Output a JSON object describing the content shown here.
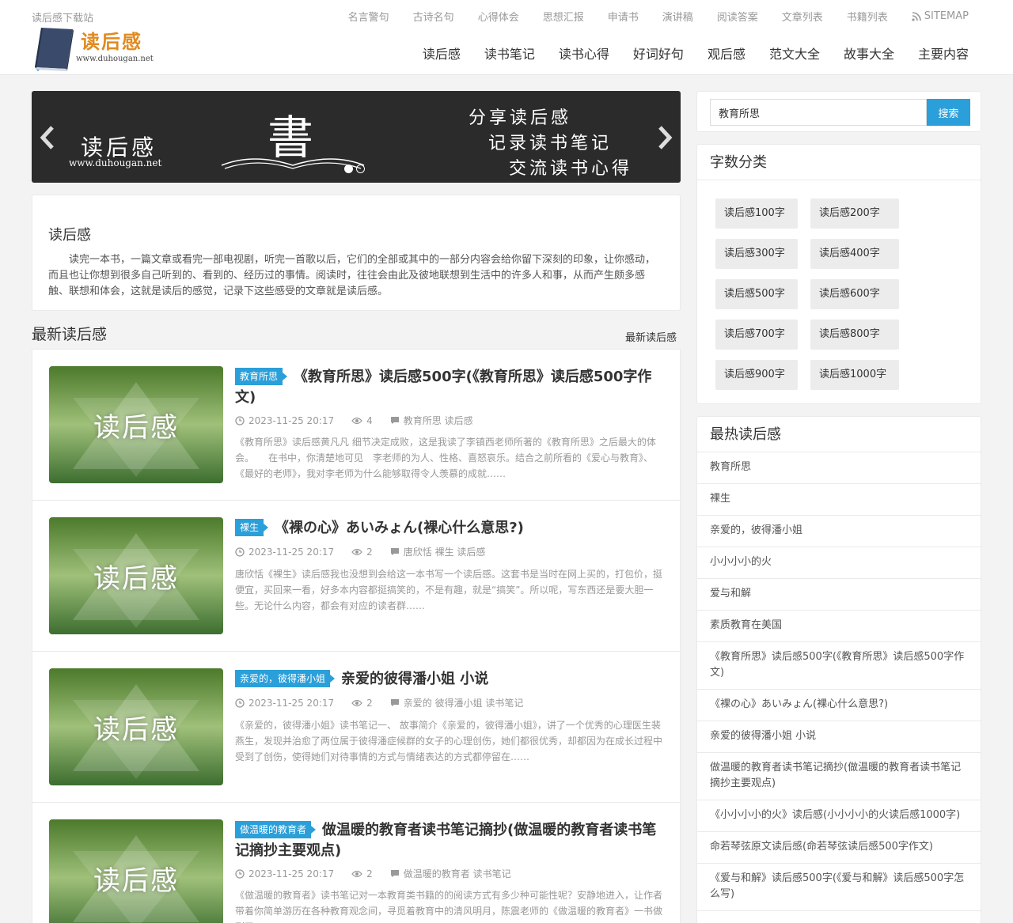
{
  "header": {
    "site_download": "读后感下载站",
    "top_nav": [
      "名言警句",
      "古诗名句",
      "心得体会",
      "思想汇报",
      "申请书",
      "演讲稿",
      "阅读答案",
      "文章列表",
      "书籍列表"
    ],
    "sitemap": "SITEMAP",
    "logo_title": "读后感",
    "logo_url": "www.duhougan.net",
    "main_nav": [
      "读后感",
      "读书笔记",
      "读书心得",
      "好词好句",
      "观后感",
      "范文大全",
      "故事大全",
      "主要内容"
    ]
  },
  "slider": {
    "left_title": "读后感",
    "left_url": "www.duhougan.net",
    "center_char": "書",
    "lines": [
      "分享读后感",
      "记录读书笔记",
      "交流读书心得"
    ]
  },
  "intro": {
    "title": "读后感",
    "text": "读完一本书，一篇文章或看完一部电视剧，听完一首歌以后，它们的全部或其中的一部分内容会给你留下深刻的印象，让你感动，而且也让你想到很多自己听到的、看到的、经历过的事情。阅读时，往往会由此及彼地联想到生活中的许多人和事，从而产生颇多感触、联想和体会，这就是读后的感觉，记录下这些感受的文章就是读后感。"
  },
  "latest": {
    "title": "最新读后感",
    "more": "最新读后感",
    "thumb_text": "读后感",
    "articles": [
      {
        "badge": "教育所思",
        "title": "《教育所思》读后感500字(《教育所思》读后感500字作文)",
        "date": "2023-11-25 20:17",
        "views": "4",
        "tags": "教育所思 读后感",
        "excerpt": "《教育所思》读后感黄凡凡 细节决定成败，这是我读了李镇西老师所著的《教育所思》之后最大的体会。　　在书中，你清楚地可见　李老师的为人、性格、喜怒哀乐。结合之前所看的《爱心与教育》、《最好的老师》，我对李老师为什么能够取得令人羡慕的成就……"
      },
      {
        "badge": "裸生",
        "title": "《裸の心》あいみょん(裸心什么意思?)",
        "date": "2023-11-25 20:17",
        "views": "2",
        "tags": "唐欣恬 裸生 读后感",
        "excerpt": "唐欣恬《裸生》读后感我也没想到会给这一本书写一个读后感。这套书是当时在网上买的，打包价，挺便宜，买回来一看，好多本内容都挺搞笑的，不是有趣，就是“搞笑”。所以呢，写东西还是要大胆一些。无论什么内容，都会有对应的读者群……"
      },
      {
        "badge": "亲爱的，彼得潘小姐",
        "title": "亲爱的彼得潘小姐 小说",
        "date": "2023-11-25 20:17",
        "views": "2",
        "tags": "亲爱的 彼得潘小姐 读书笔记",
        "excerpt": "《亲爱的，彼得潘小姐》读书笔记一、 故事简介《亲爱的，彼得潘小姐》，讲了一个优秀的心理医生裴燕生，发现并治愈了两位属于彼得潘症候群的女子的心理创伤，她们都很优秀，却都因为在成长过程中受到了创伤，使得她们对待事情的方式与情绪表达的方式都停留在……"
      },
      {
        "badge": "做温暖的教育者",
        "title": "做温暖的教育者读书笔记摘抄(做温暖的教育者读书笔记摘抄主要观点)",
        "date": "2023-11-25 20:17",
        "views": "2",
        "tags": "做温暖的教育者 读书笔记",
        "excerpt": "《做温暖的教育者》读书笔记对一本教育类书籍的的阅读方式有多少种可能性呢？安静地进入，让作者带着你简单游历在各种教育观念间，寻觅着教育中的清风明月，陈震老师的《做温暖的教育者》一书做到了……"
      }
    ]
  },
  "sidebar": {
    "search_value": "教育所思",
    "search_button": "搜索",
    "word_count_title": "字数分类",
    "word_tags": [
      "读后感100字",
      "读后感200字",
      "读后感300字",
      "读后感400字",
      "读后感500字",
      "读后感600字",
      "读后感700字",
      "读后感800字",
      "读后感900字",
      "读后感1000字"
    ],
    "hot_title": "最热读后感",
    "hot_items": [
      "教育所思",
      "裸生",
      "亲爱的，彼得潘小姐",
      "小小小小的火",
      "爱与和解",
      "素质教育在美国",
      "《教育所思》读后感500字(《教育所思》读后感500字作文)",
      "《裸の心》あいみょん(裸心什么意思?)",
      "亲爱的彼得潘小姐 小说",
      "做温暖的教育者读书笔记摘抄(做温暖的教育者读书笔记摘抄主要观点)",
      "《小小小小的火》读后感(小小小小的火读后感1000字)",
      "命若琴弦原文读后感(命若琴弦读后感500字作文)",
      "《爱与和解》读后感500字(《爱与和解》读后感500字怎么写)"
    ]
  },
  "colors": {
    "accent": "#2b9fd9",
    "logo": "#e08a1e",
    "slider_bg": "#2b2b2b"
  }
}
